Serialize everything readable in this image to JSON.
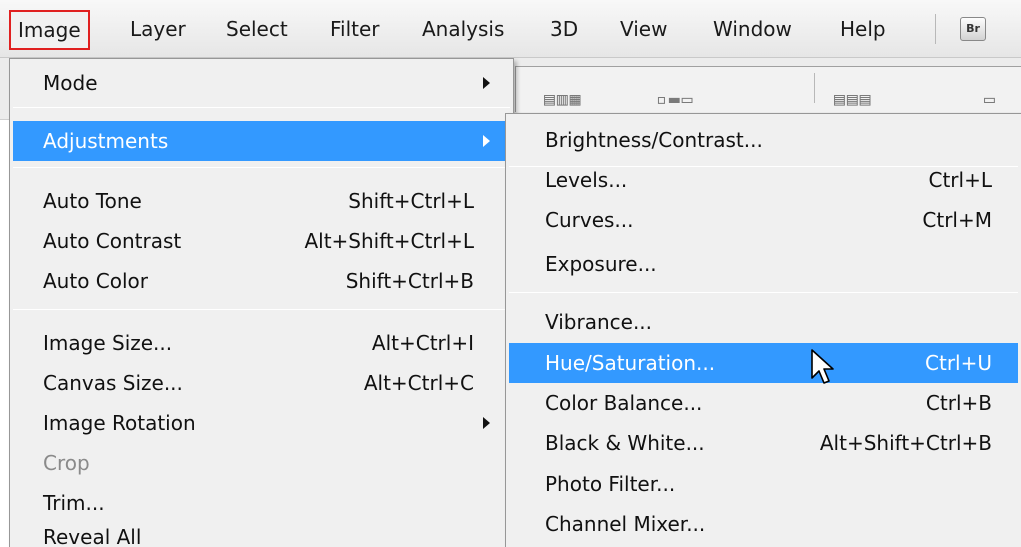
{
  "menubar": {
    "items": [
      {
        "label": "Image",
        "active": true
      },
      {
        "label": "Layer"
      },
      {
        "label": "Select"
      },
      {
        "label": "Filter"
      },
      {
        "label": "Analysis"
      },
      {
        "label": "3D"
      },
      {
        "label": "View"
      },
      {
        "label": "Window"
      },
      {
        "label": "Help"
      }
    ],
    "bridge_label": "Br"
  },
  "image_menu": {
    "items": [
      {
        "label": "Mode",
        "shortcut": "",
        "submenu": true
      },
      {
        "label": "Adjustments",
        "shortcut": "",
        "submenu": true,
        "highlighted": true
      },
      {
        "label": "Auto Tone",
        "shortcut": "Shift+Ctrl+L"
      },
      {
        "label": "Auto Contrast",
        "shortcut": "Alt+Shift+Ctrl+L"
      },
      {
        "label": "Auto Color",
        "shortcut": "Shift+Ctrl+B"
      },
      {
        "label": "Image Size...",
        "shortcut": "Alt+Ctrl+I"
      },
      {
        "label": "Canvas Size...",
        "shortcut": "Alt+Ctrl+C"
      },
      {
        "label": "Image Rotation",
        "shortcut": "",
        "submenu": true
      },
      {
        "label": "Crop",
        "shortcut": "",
        "disabled": true
      },
      {
        "label": "Trim...",
        "shortcut": ""
      },
      {
        "label": "Reveal All",
        "shortcut": ""
      }
    ]
  },
  "adjustments_menu": {
    "items": [
      {
        "label": "Brightness/Contrast...",
        "shortcut": ""
      },
      {
        "label": "Levels...",
        "shortcut": "Ctrl+L"
      },
      {
        "label": "Curves...",
        "shortcut": "Ctrl+M"
      },
      {
        "label": "Exposure...",
        "shortcut": ""
      },
      {
        "label": "Vibrance...",
        "shortcut": ""
      },
      {
        "label": "Hue/Saturation...",
        "shortcut": "Ctrl+U",
        "highlighted": true
      },
      {
        "label": "Color Balance...",
        "shortcut": "Ctrl+B"
      },
      {
        "label": "Black & White...",
        "shortcut": "Alt+Shift+Ctrl+B"
      },
      {
        "label": "Photo Filter...",
        "shortcut": ""
      },
      {
        "label": "Channel Mixer...",
        "shortcut": ""
      }
    ]
  },
  "colors": {
    "highlight": "#3399ff",
    "active_outline": "#e02020"
  }
}
